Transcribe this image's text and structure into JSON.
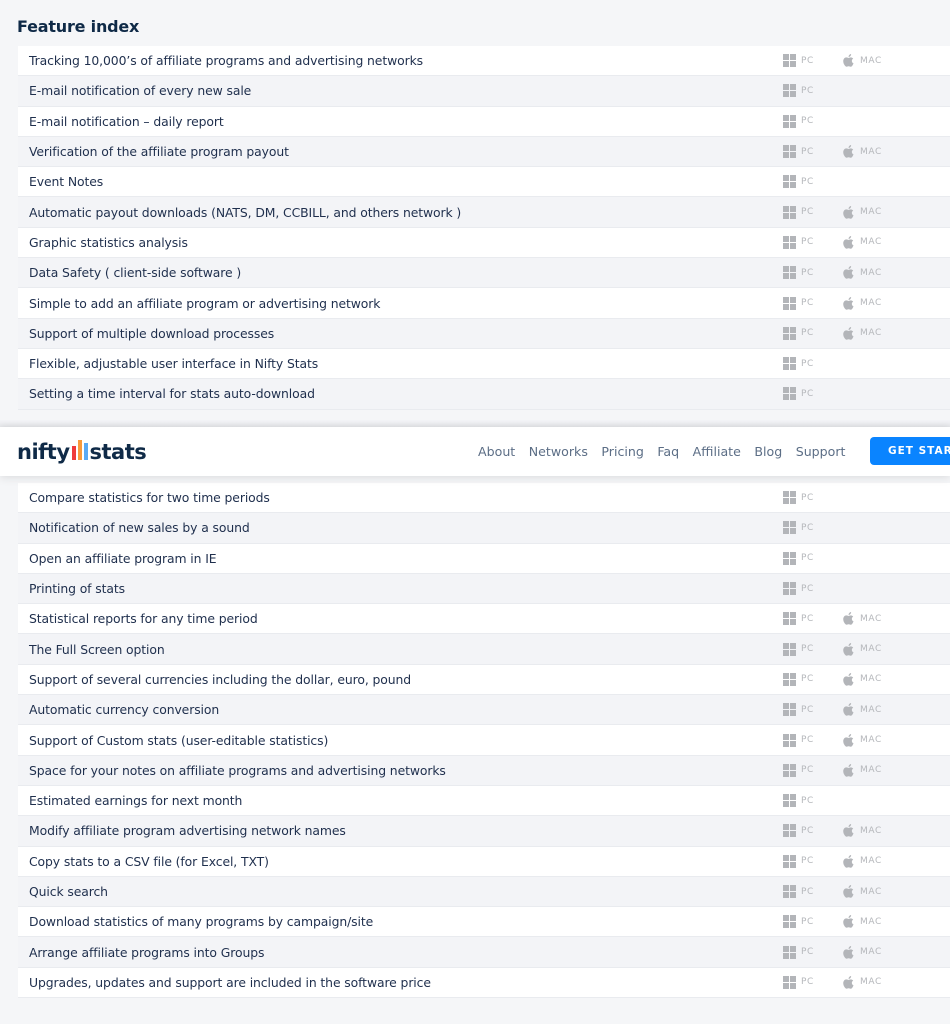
{
  "page": {
    "title": "Feature index"
  },
  "header": {
    "logo": {
      "left_text": "nifty",
      "right_text": "stats",
      "bar_colors": [
        "#ef3b3b",
        "#f99a3c",
        "#5aaaf5"
      ]
    },
    "nav": [
      "About",
      "Networks",
      "Pricing",
      "Faq",
      "Affiliate",
      "Blog",
      "Support"
    ],
    "cta_label": "GET STARTED",
    "cta_color": "#0a84ff"
  },
  "platform_labels": {
    "pc": "PC",
    "mac": "MAC"
  },
  "features_top": [
    {
      "label": "Tracking 10,000’s of affiliate programs and advertising networks",
      "pc": true,
      "mac": true
    },
    {
      "label": "E-mail notification of every new sale",
      "pc": true,
      "mac": false
    },
    {
      "label": "E-mail notification – daily report",
      "pc": true,
      "mac": false
    },
    {
      "label": "Verification of the affiliate program payout",
      "pc": true,
      "mac": true
    },
    {
      "label": "Event Notes",
      "pc": true,
      "mac": false
    },
    {
      "label": "Automatic payout downloads (NATS, DM, CCBILL, and others network )",
      "pc": true,
      "mac": true
    },
    {
      "label": "Graphic statistics analysis",
      "pc": true,
      "mac": true
    },
    {
      "label": "Data Safety ( client-side software )",
      "pc": true,
      "mac": true
    },
    {
      "label": "Simple to add an affiliate program or advertising network",
      "pc": true,
      "mac": true
    },
    {
      "label": "Support of multiple download processes",
      "pc": true,
      "mac": true
    },
    {
      "label": "Flexible, adjustable user interface in Nifty Stats",
      "pc": true,
      "mac": false
    },
    {
      "label": "Setting a time interval for stats auto-download",
      "pc": true,
      "mac": false
    }
  ],
  "features_bottom": [
    {
      "label": "Compare statistics for two time periods",
      "pc": true,
      "mac": false
    },
    {
      "label": "Notification of new sales by a sound",
      "pc": true,
      "mac": false
    },
    {
      "label": "Open an affiliate program in IE",
      "pc": true,
      "mac": false
    },
    {
      "label": "Printing of stats",
      "pc": true,
      "mac": false
    },
    {
      "label": "Statistical reports for any time period",
      "pc": true,
      "mac": true
    },
    {
      "label": "The Full Screen option",
      "pc": true,
      "mac": true
    },
    {
      "label": "Support of several currencies including the dollar, euro, pound",
      "pc": true,
      "mac": true
    },
    {
      "label": "Automatic currency conversion",
      "pc": true,
      "mac": true
    },
    {
      "label": "Support of Custom stats (user-editable statistics)",
      "pc": true,
      "mac": true
    },
    {
      "label": "Space for your notes on affiliate programs and advertising networks",
      "pc": true,
      "mac": true
    },
    {
      "label": "Estimated earnings for next month",
      "pc": true,
      "mac": false
    },
    {
      "label": "Modify affiliate program advertising network names",
      "pc": true,
      "mac": true
    },
    {
      "label": "Copy stats to a CSV file (for Excel, TXT)",
      "pc": true,
      "mac": true
    },
    {
      "label": "Quick search",
      "pc": true,
      "mac": true
    },
    {
      "label": "Download statistics of many programs by campaign/site",
      "pc": true,
      "mac": true
    },
    {
      "label": "Arrange affiliate programs into Groups",
      "pc": true,
      "mac": true
    },
    {
      "label": "Upgrades, updates and support are included in the software price",
      "pc": true,
      "mac": true
    }
  ]
}
